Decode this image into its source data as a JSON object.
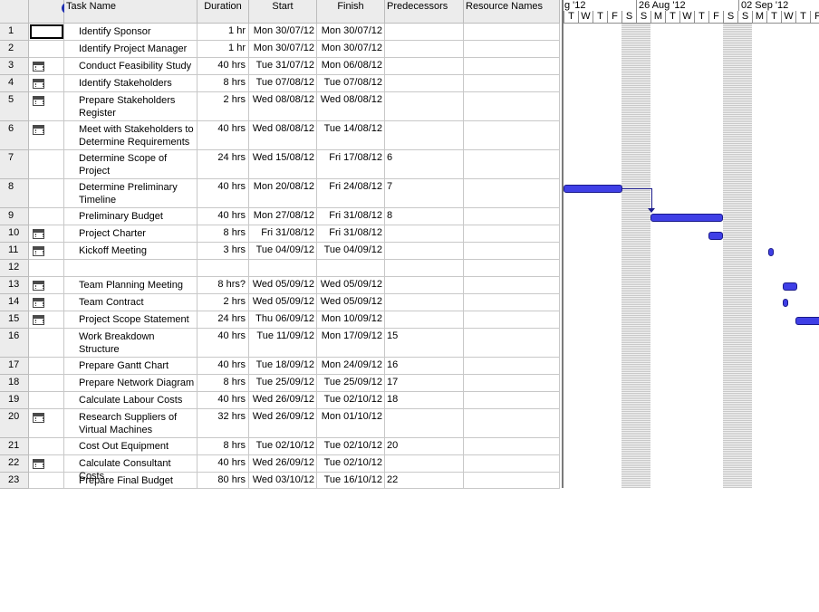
{
  "columns": {
    "indicators_icon": "info-icon",
    "name": "Task Name",
    "duration": "Duration",
    "start": "Start",
    "finish": "Finish",
    "predecessors": "Predecessors",
    "resources": "Resource Names"
  },
  "timescale": {
    "weeks": [
      "g '12",
      "26 Aug '12",
      "02 Sep '12"
    ],
    "days_a": [
      "T",
      "W",
      "T",
      "F",
      "S",
      "S",
      "M",
      "T",
      "W",
      "T",
      "F",
      "S",
      "S",
      "M",
      "T",
      "W",
      "T",
      "F"
    ]
  },
  "tasks": [
    {
      "id": "1",
      "name": "Identify Sponsor",
      "duration": "1 hr",
      "start": "Mon 30/07/12",
      "finish": "Mon 30/07/12",
      "pred": "",
      "icon": false,
      "sel": true
    },
    {
      "id": "2",
      "name": "Identify Project Manager",
      "duration": "1 hr",
      "start": "Mon 30/07/12",
      "finish": "Mon 30/07/12",
      "pred": "",
      "icon": false
    },
    {
      "id": "3",
      "name": "Conduct Feasibility Study",
      "duration": "40 hrs",
      "start": "Tue 31/07/12",
      "finish": "Mon 06/08/12",
      "pred": "",
      "icon": true
    },
    {
      "id": "4",
      "name": "Identify Stakeholders",
      "duration": "8 hrs",
      "start": "Tue 07/08/12",
      "finish": "Tue 07/08/12",
      "pred": "",
      "icon": true
    },
    {
      "id": "5",
      "name": "Prepare Stakeholders Register",
      "duration": "2 hrs",
      "start": "Wed 08/08/12",
      "finish": "Wed 08/08/12",
      "pred": "",
      "icon": true
    },
    {
      "id": "6",
      "name": "Meet with Stakeholders to Determine Requirements",
      "duration": "40 hrs",
      "start": "Wed 08/08/12",
      "finish": "Tue 14/08/12",
      "pred": "",
      "icon": true
    },
    {
      "id": "7",
      "name": "Determine Scope of Project",
      "duration": "24 hrs",
      "start": "Wed 15/08/12",
      "finish": "Fri 17/08/12",
      "pred": "6",
      "icon": false
    },
    {
      "id": "8",
      "name": "Determine Preliminary Timeline",
      "duration": "40 hrs",
      "start": "Mon 20/08/12",
      "finish": "Fri 24/08/12",
      "pred": "7",
      "icon": false
    },
    {
      "id": "9",
      "name": "Preliminary Budget",
      "duration": "40 hrs",
      "start": "Mon 27/08/12",
      "finish": "Fri 31/08/12",
      "pred": "8",
      "icon": false
    },
    {
      "id": "10",
      "name": "Project Charter",
      "duration": "8 hrs",
      "start": "Fri 31/08/12",
      "finish": "Fri 31/08/12",
      "pred": "",
      "icon": true
    },
    {
      "id": "11",
      "name": "Kickoff Meeting",
      "duration": "3 hrs",
      "start": "Tue 04/09/12",
      "finish": "Tue 04/09/12",
      "pred": "",
      "icon": true
    },
    {
      "id": "12",
      "name": "",
      "duration": "",
      "start": "",
      "finish": "",
      "pred": "",
      "icon": false
    },
    {
      "id": "13",
      "name": "Team Planning Meeting",
      "duration": "8 hrs?",
      "start": "Wed 05/09/12",
      "finish": "Wed 05/09/12",
      "pred": "",
      "icon": true
    },
    {
      "id": "14",
      "name": "Team Contract",
      "duration": "2 hrs",
      "start": "Wed 05/09/12",
      "finish": "Wed 05/09/12",
      "pred": "",
      "icon": true
    },
    {
      "id": "15",
      "name": "Project Scope Statement",
      "duration": "24 hrs",
      "start": "Thu 06/09/12",
      "finish": "Mon 10/09/12",
      "pred": "",
      "icon": true
    },
    {
      "id": "16",
      "name": "Work Breakdown Structure",
      "duration": "40 hrs",
      "start": "Tue 11/09/12",
      "finish": "Mon 17/09/12",
      "pred": "15",
      "icon": false
    },
    {
      "id": "17",
      "name": "Prepare Gantt Chart",
      "duration": "40 hrs",
      "start": "Tue 18/09/12",
      "finish": "Mon 24/09/12",
      "pred": "16",
      "icon": false
    },
    {
      "id": "18",
      "name": "Prepare Network Diagram",
      "duration": "8 hrs",
      "start": "Tue 25/09/12",
      "finish": "Tue 25/09/12",
      "pred": "17",
      "icon": false
    },
    {
      "id": "19",
      "name": "Calculate Labour Costs",
      "duration": "40 hrs",
      "start": "Wed 26/09/12",
      "finish": "Tue 02/10/12",
      "pred": "18",
      "icon": false
    },
    {
      "id": "20",
      "name": "Research Suppliers of Virtual Machines",
      "duration": "32 hrs",
      "start": "Wed 26/09/12",
      "finish": "Mon 01/10/12",
      "pred": "",
      "icon": true
    },
    {
      "id": "21",
      "name": "Cost Out Equipment",
      "duration": "8 hrs",
      "start": "Tue 02/10/12",
      "finish": "Tue 02/10/12",
      "pred": "20",
      "icon": false
    },
    {
      "id": "22",
      "name": "Calculate Consultant Costs",
      "duration": "40 hrs",
      "start": "Wed 26/09/12",
      "finish": "Tue 02/10/12",
      "pred": "",
      "icon": true
    },
    {
      "id": "23",
      "name": "Prepare Final Budget",
      "duration": "80 hrs",
      "start": "Wed 03/10/12",
      "finish": "Tue 16/10/12",
      "pred": "22",
      "icon": false
    }
  ],
  "colors": {
    "bar": "#3f3fe6",
    "bar_border": "#1a1a8a",
    "header": "#ececec"
  }
}
